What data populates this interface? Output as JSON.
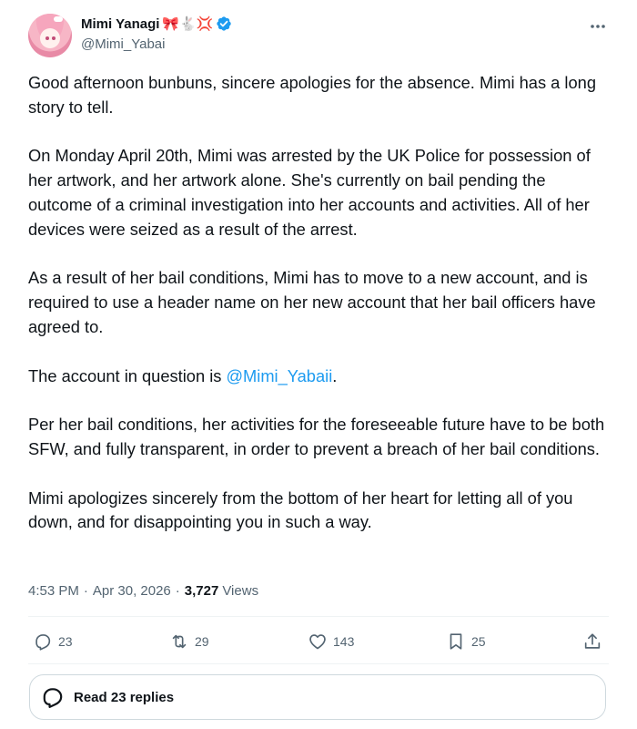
{
  "author": {
    "display_name": "Mimi Yanagi",
    "emojis": "🎀🐇💢",
    "handle": "@Mimi_Yabai",
    "verified": true
  },
  "icons": {
    "more": "more-horizontal-icon",
    "verified": "verified-badge-icon",
    "reply": "reply-icon",
    "repost": "repost-icon",
    "like": "heart-icon",
    "bookmark": "bookmark-icon",
    "share": "share-icon",
    "read_replies": "chat-bubble-icon"
  },
  "colors": {
    "text": "#0f1419",
    "secondary": "#536471",
    "link": "#1d9bf0",
    "verified": "#1d9bf0",
    "border": "#cfd9de"
  },
  "post": {
    "para1": "Good afternoon bunbuns, sincere apologies for the absence. Mimi has a long story to tell.",
    "para2": "On Monday April 20th, Mimi was arrested by the UK Police for possession of her artwork, and her artwork alone. She's currently on bail pending the outcome of a criminal investigation into her accounts and activities. All of her devices were seized as a result of the arrest.",
    "para3": "As a result of her bail conditions, Mimi has to move to a new account, and is required to use a header name on her new account that her bail officers have agreed to.",
    "para4_prefix": "The account in question is ",
    "para4_mention": "@Mimi_Yabaii",
    "para4_suffix": ".",
    "para5": "Per her bail conditions, her activities for the foreseeable future have to be both SFW, and fully transparent, in order to prevent a breach of her bail conditions.",
    "para6": "Mimi apologizes sincerely from the bottom of her heart for letting all of you down, and for disappointing you in such a way."
  },
  "meta": {
    "time": "4:53 PM",
    "date": "Apr 30, 2026",
    "separator": "·",
    "views_count": "3,727",
    "views_label": "Views"
  },
  "actions": {
    "replies": "23",
    "reposts": "29",
    "likes": "143",
    "bookmarks": "25"
  },
  "read_replies_label": "Read 23 replies"
}
